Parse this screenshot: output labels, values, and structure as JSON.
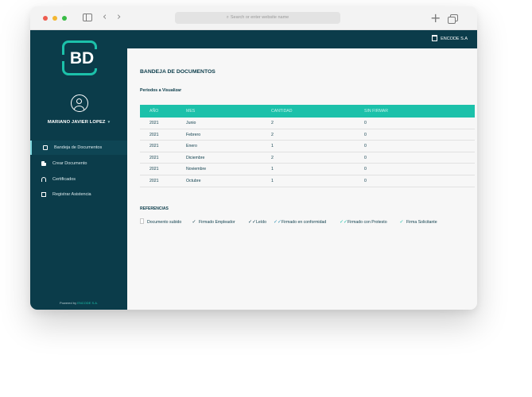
{
  "browser": {
    "address_placeholder": "Search or enter website name"
  },
  "sidebar": {
    "logo_text": "BD",
    "user_name": "MARIANO JAVIER LOPEZ",
    "items": [
      {
        "label": "Bandeja de Documentos"
      },
      {
        "label": "Crear Documento"
      },
      {
        "label": "Certificados"
      },
      {
        "label": "Registrar Asistencia"
      }
    ],
    "powered_prefix": "Powered by",
    "powered_brand": "ENCODE S.A."
  },
  "topbar": {
    "company": "ENCODE S.A"
  },
  "main": {
    "title": "BANDEJA DE DOCUMENTOS",
    "period_label": "Periodos a Visualizar",
    "table": {
      "headers": [
        "AÑO",
        "MES",
        "CANTIDAD",
        "SIN FIRMAR"
      ],
      "rows": [
        [
          "2021",
          "Junio",
          "2",
          "0"
        ],
        [
          "2021",
          "Febrero",
          "2",
          "0"
        ],
        [
          "2021",
          "Enero",
          "1",
          "0"
        ],
        [
          "2021",
          "Diciembre",
          "2",
          "0"
        ],
        [
          "2021",
          "Noviembre",
          "1",
          "0"
        ],
        [
          "2021",
          "Octubre",
          "1",
          "0"
        ]
      ]
    },
    "refs_title": "REFERENCIAS",
    "refs": [
      {
        "label": "Documento subido"
      },
      {
        "label": "Firmado Empleador"
      },
      {
        "label": "Leído"
      },
      {
        "label": "Firmado en conformidad"
      },
      {
        "label": "Firmado con Protesto"
      },
      {
        "label": "Firma Solicitante"
      }
    ]
  },
  "colors": {
    "sidebar_bg": "#0b3c4a",
    "accent": "#1cc1aa",
    "text_dark": "#0b3c4a"
  }
}
